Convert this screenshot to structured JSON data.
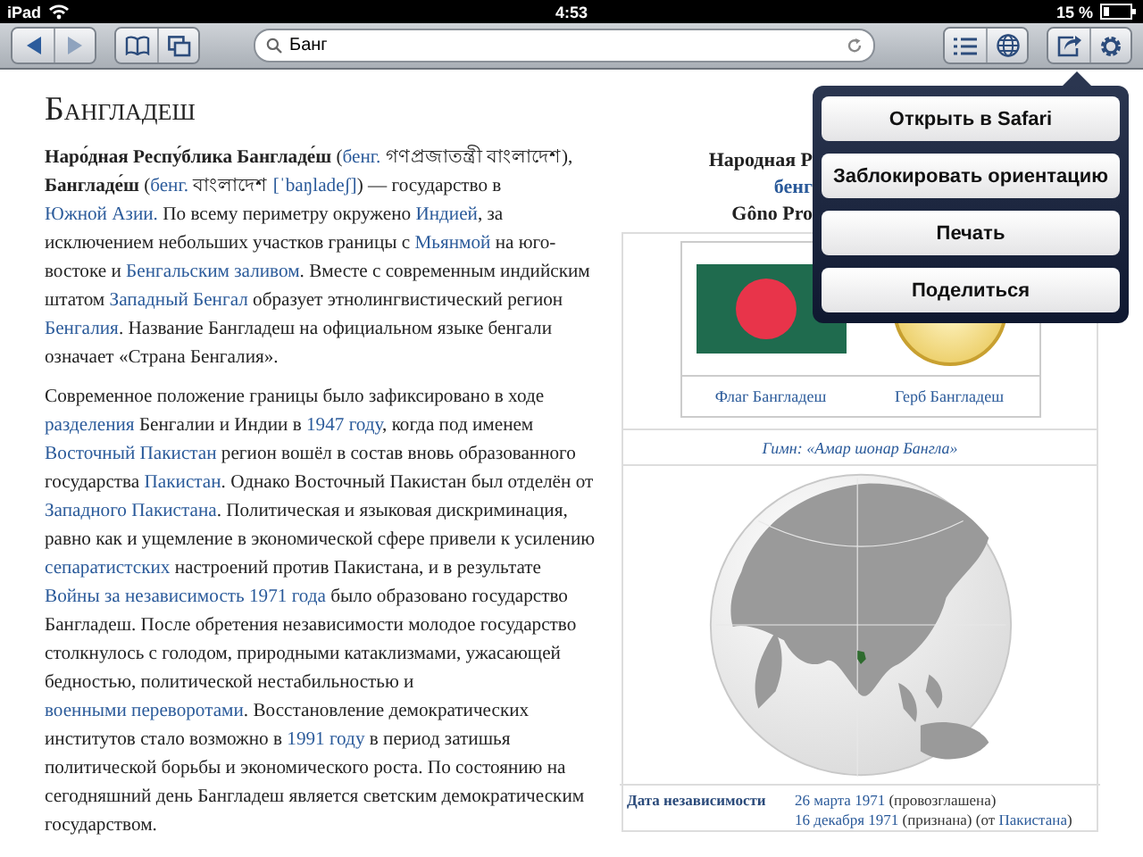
{
  "status_bar": {
    "device": "iPad",
    "time": "4:53",
    "battery": "15 %"
  },
  "toolbar": {
    "address": {
      "value": "Банг"
    }
  },
  "article": {
    "title": "Бангладеш",
    "paragraphs": [
      {
        "segments": [
          {
            "kind": "text",
            "text": "**Наро́дная Респу́блика Бангладе́ш** ("
          },
          {
            "kind": "link",
            "text": "бенг."
          },
          {
            "kind": "text",
            "text": " গণপ্রজাতন্ত্রী বাংলাদেশ), **Бангладе́ш** ("
          },
          {
            "kind": "link",
            "text": "бенг."
          },
          {
            "kind": "text",
            "text": " বাংলাদেশ "
          },
          {
            "kind": "link",
            "text": "[ˈbaŋladeʃ]"
          },
          {
            "kind": "text",
            "text": ") — государство в "
          },
          {
            "kind": "link",
            "text": "Южной Азии."
          },
          {
            "kind": "text",
            "text": " По всему периметру окружено "
          },
          {
            "kind": "link",
            "text": "Индией"
          },
          {
            "kind": "text",
            "text": ", за исключением небольших участков границы с "
          },
          {
            "kind": "link",
            "text": "Мьянмой"
          },
          {
            "kind": "text",
            "text": " на юго-востоке и "
          },
          {
            "kind": "link",
            "text": "Бенгальским заливом"
          },
          {
            "kind": "text",
            "text": ". Вместе с современным индийским штатом "
          },
          {
            "kind": "link",
            "text": "Западный Бенгал"
          },
          {
            "kind": "text",
            "text": " образует этнолингвистический регион "
          },
          {
            "kind": "link",
            "text": "Бенгалия"
          },
          {
            "kind": "text",
            "text": ". Название Бангладеш на официальном языке бенгали означает «Страна Бенгалия»."
          }
        ]
      },
      {
        "segments": [
          {
            "kind": "text",
            "text": "Современное положение границы было зафиксировано в ходе "
          },
          {
            "kind": "link",
            "text": "разделения"
          },
          {
            "kind": "text",
            "text": " Бенгалии и Индии в "
          },
          {
            "kind": "link",
            "text": "1947 году"
          },
          {
            "kind": "text",
            "text": ", когда под именем "
          },
          {
            "kind": "link",
            "text": "Восточный Пакистан"
          },
          {
            "kind": "text",
            "text": " регион вошёл в состав вновь образованного государства "
          },
          {
            "kind": "link",
            "text": "Пакистан"
          },
          {
            "kind": "text",
            "text": ". Однако Восточный Пакистан был отделён от "
          },
          {
            "kind": "link",
            "text": "Западного Пакистана"
          },
          {
            "kind": "text",
            "text": ". Политическая и языковая дискриминация, равно как и ущемление в экономической сфере привели к усилению "
          },
          {
            "kind": "link",
            "text": "сепаратистских"
          },
          {
            "kind": "text",
            "text": " настроений против Пакистана, и в результате "
          },
          {
            "kind": "link",
            "text": "Войны за независимость 1971 года"
          },
          {
            "kind": "text",
            "text": " было образовано государство Бангладеш. После обретения независимости молодое государство столкнулось с голодом, природными катаклизмами, ужасающей бедностью, политической нестабильностью и "
          },
          {
            "kind": "link",
            "text": "военными переворотами"
          },
          {
            "kind": "text",
            "text": ". Восстановление демократических институтов стало возможно в "
          },
          {
            "kind": "link",
            "text": "1991 году"
          },
          {
            "kind": "text",
            "text": " в период затишья политической борьбы и экономического роста. По состоянию на сегодняшний день Бангладеш является светским демократическим государством."
          }
        ]
      }
    ]
  },
  "infobox": {
    "header_lines": [
      {
        "kind": "text",
        "text": "Народная Р"
      },
      {
        "kind": "link",
        "text": "бенг"
      },
      {
        "kind": "text",
        "text": "Gôno Pro"
      }
    ],
    "emblems": [
      {
        "kind": "flag",
        "caption": "Флаг Бангладеш"
      },
      {
        "kind": "coat_of_arms",
        "caption": "Герб Бангладеш"
      }
    ],
    "anthem": "Гимн: «Амар шонар Бангла»",
    "facts": [
      {
        "label": "Дата независимости",
        "segments": [
          {
            "kind": "link",
            "text": "26 марта 1971"
          },
          {
            "kind": "text",
            "text": " (провозглашена)"
          }
        ]
      },
      {
        "segments": [
          {
            "kind": "link",
            "text": "16 декабря 1971"
          },
          {
            "kind": "text",
            "text": " (признана) (от "
          },
          {
            "kind": "link",
            "text": "Пакистана"
          },
          {
            "kind": "text",
            "text": ")"
          }
        ]
      }
    ]
  },
  "popup_menu": {
    "items": [
      "Открыть в Safari",
      "Заблокировать ориентацию",
      "Печать",
      "Поделиться"
    ]
  }
}
